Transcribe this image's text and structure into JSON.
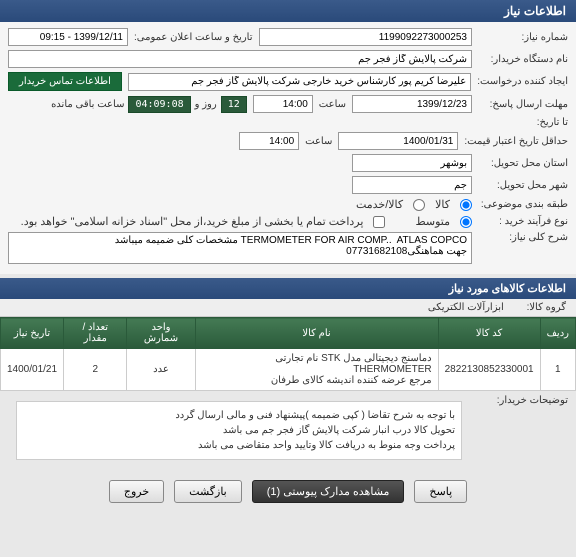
{
  "header": {
    "title": "اطلاعات نیاز"
  },
  "form": {
    "need_no_label": "شماره نیاز:",
    "need_no": "1199092273000253",
    "announce_label": "تاریخ و ساعت اعلان عمومی:",
    "announce": "1399/12/11 - 09:15",
    "buyer_org_label": "نام دستگاه خریدار:",
    "buyer_org": "شرکت پالایش گاز فجر جم",
    "creator_label": "ایجاد کننده درخواست:",
    "creator": "علیرضا کریم پور کارشناس خرید خارجی شرکت پالایش گاز فجر جم",
    "contact_btn": "اطلاعات تماس خریدار",
    "deadline_label": "مهلت ارسال پاسخ:",
    "deadline_date": "1399/12/23",
    "deadline_time": "14:00",
    "countdown_days": "12",
    "countdown_time": "04:09:08",
    "cd_day_label": "روز و",
    "cd_remain_label": "ساعت باقی مانده",
    "to_date_label": "تا تاریخ:",
    "time_label": "ساعت",
    "validity_label": "حداقل تاریخ اعتبار قیمت:",
    "validity_date": "1400/01/31",
    "validity_time": "14:00",
    "delivery_prov_label": "استان محل تحویل:",
    "delivery_prov": "بوشهر",
    "delivery_city_label": "شهر محل تحویل:",
    "delivery_city": "جم",
    "category_label": "طبقه بندی موضوعی:",
    "cat_goods": "کالا",
    "cat_service": "کالا/خدمت",
    "process_label": "نوع فرآیند خرید :",
    "proc_med": "متوسط",
    "partial_label": "پرداخت تمام یا بخشی از مبلغ خرید،از محل \"اسناد خزانه اسلامی\" خواهد بود.",
    "desc_label": "شرح کلی نیاز:",
    "desc": "TERMOMETER FOR AIR COMP..  ATLAS COPCO مشخصات کلی ضمیمه میباشد\nجهت هماهنگی07731682108"
  },
  "items_section": {
    "title": "اطلاعات کالاهای مورد نیاز",
    "group_label": "گروه کالا:",
    "group_value": "ابزارآلات الکتریکی"
  },
  "table": {
    "headers": [
      "ردیف",
      "کد کالا",
      "نام کالا",
      "واحد شمارش",
      "تعداد / مقدار",
      "تاریخ نیاز"
    ],
    "rows": [
      {
        "idx": "1",
        "code": "2822130852330001",
        "name": "دماسنج دیجیتالی مدل STK نام تجارتی THERMOMETER\nمرجع عرضه کننده اندیشه کالای طرفان",
        "unit": "عدد",
        "qty": "2",
        "date": "1400/01/21"
      }
    ]
  },
  "note": {
    "label": "توضیحات خریدار:",
    "text": "با توجه به شرح تقاضا ( کپی ضمیمه )پیشنهاد فنی و مالی ارسال گردد\nتحویل کالا درب انبار شرکت  پالایش گاز فجر جم می باشد\nپرداخت وجه منوط به دریافت کالا وتایید واحد متقاضی می باشد"
  },
  "footer": {
    "respond": "پاسخ",
    "attachments": "مشاهده مدارک پیوستی (1)",
    "back": "بازگشت",
    "exit": "خروج"
  }
}
